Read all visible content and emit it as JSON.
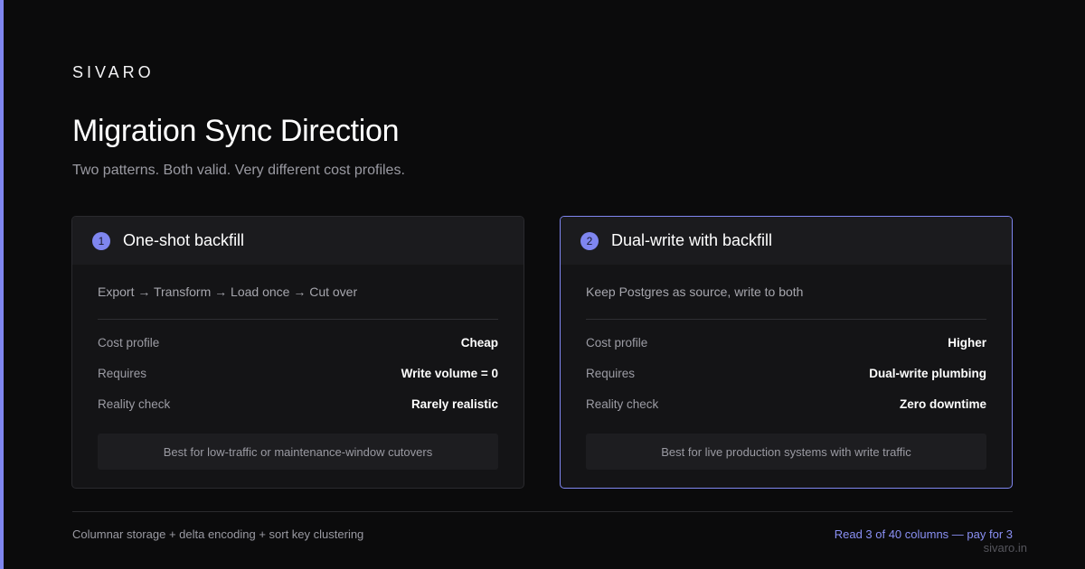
{
  "brand": "SIVARO",
  "title": "Migration Sync Direction",
  "subtitle": "Two patterns. Both valid. Very different cost profiles.",
  "accent_color": "#7f86f0",
  "cards": [
    {
      "number": "1",
      "title": "One-shot backfill",
      "flow": "Export → Transform → Load once → Cut over",
      "rows": [
        {
          "label": "Cost profile",
          "value": "Cheap"
        },
        {
          "label": "Requires",
          "value": "Write volume = 0"
        },
        {
          "label": "Reality check",
          "value": "Rarely realistic"
        }
      ],
      "note": "Best for low-traffic or maintenance-window cutovers",
      "highlighted": false
    },
    {
      "number": "2",
      "title": "Dual-write with backfill",
      "flow": "Keep Postgres as source, write to both",
      "rows": [
        {
          "label": "Cost profile",
          "value": "Higher"
        },
        {
          "label": "Requires",
          "value": "Dual-write plumbing"
        },
        {
          "label": "Reality check",
          "value": "Zero downtime"
        }
      ],
      "note": "Best for live production systems with write traffic",
      "highlighted": true
    }
  ],
  "footer": {
    "left": "Columnar storage + delta encoding + sort key clustering",
    "right": "Read 3 of 40 columns — pay for 3"
  },
  "watermark": "sivaro.in"
}
